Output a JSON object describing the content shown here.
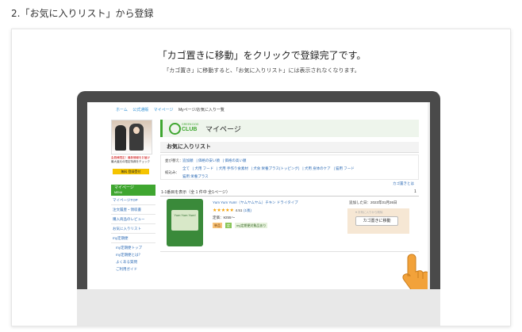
{
  "step_title": "2.「お気に入りリスト」から登録",
  "headline": "「カゴ置きに移動」をクリックで登録完了です。",
  "subline": "「カゴ置き」に移動すると、「お気に入りリスト」には表示されなくなります。",
  "breadcrumb": [
    "ホーム",
    "公式通販",
    "マイページ",
    "Myページ/お気に入り一覧"
  ],
  "banner": {
    "line1": "会員様限定！最新情報をお届け",
    "line2": "最大還元の限定特典をチェック",
    "button": "無料 登録受付"
  },
  "side_menu": {
    "header": "マイページ",
    "header_sub": "MENU",
    "items": [
      "マイページTOP",
      "注文履歴・領収書",
      "購入商品のレビュー",
      "お気に入りリスト",
      "my定期便"
    ],
    "subitems": [
      "my定期便トップ",
      "my定期便とは？",
      "よくある質問",
      "ご利用ガイド"
    ]
  },
  "logo": {
    "small": "GREEN DOG",
    "club": "CLUB"
  },
  "mypage_title": "マイページ",
  "fav_title": "お気に入りリスト",
  "sort": {
    "label": "並び替え：",
    "options": [
      "追加順",
      "価格の安い順",
      "価格の高い順"
    ]
  },
  "narrow": {
    "label": "絞込み：",
    "options": [
      "全て",
      "犬用 フード",
      "犬用 手作り食素材",
      "犬食 栄養プラス(トッピング)",
      "犬用 身体のケア",
      "猫用 フード",
      "猫用 栄養プラス"
    ]
  },
  "cart_link": "カゴ置きとは",
  "result_count": "1-1番目を表示（全 1 件中 全1ページ）",
  "page_number": "1",
  "product": {
    "image_label": "Yum Yum Yum!",
    "name": "Yum Yum Yum!（ヤムヤムヤム）チキン ドライタイプ",
    "stars": "★★★★★",
    "rating": "4.51",
    "reviews": "(1後)",
    "price": "定価：¥255〜",
    "badge1": "単品",
    "badge2": "定",
    "badge3": "my定期便対象品あり",
    "added_date": "追加した日：2023年01月26日",
    "cart_fav": "♥ お気に入りから削除",
    "cart_button": "カゴ置きに移動"
  },
  "colors": {
    "brand_green": "#3fa630",
    "link_blue": "#2d6bb5",
    "hand_orange": "#f2a23a"
  }
}
